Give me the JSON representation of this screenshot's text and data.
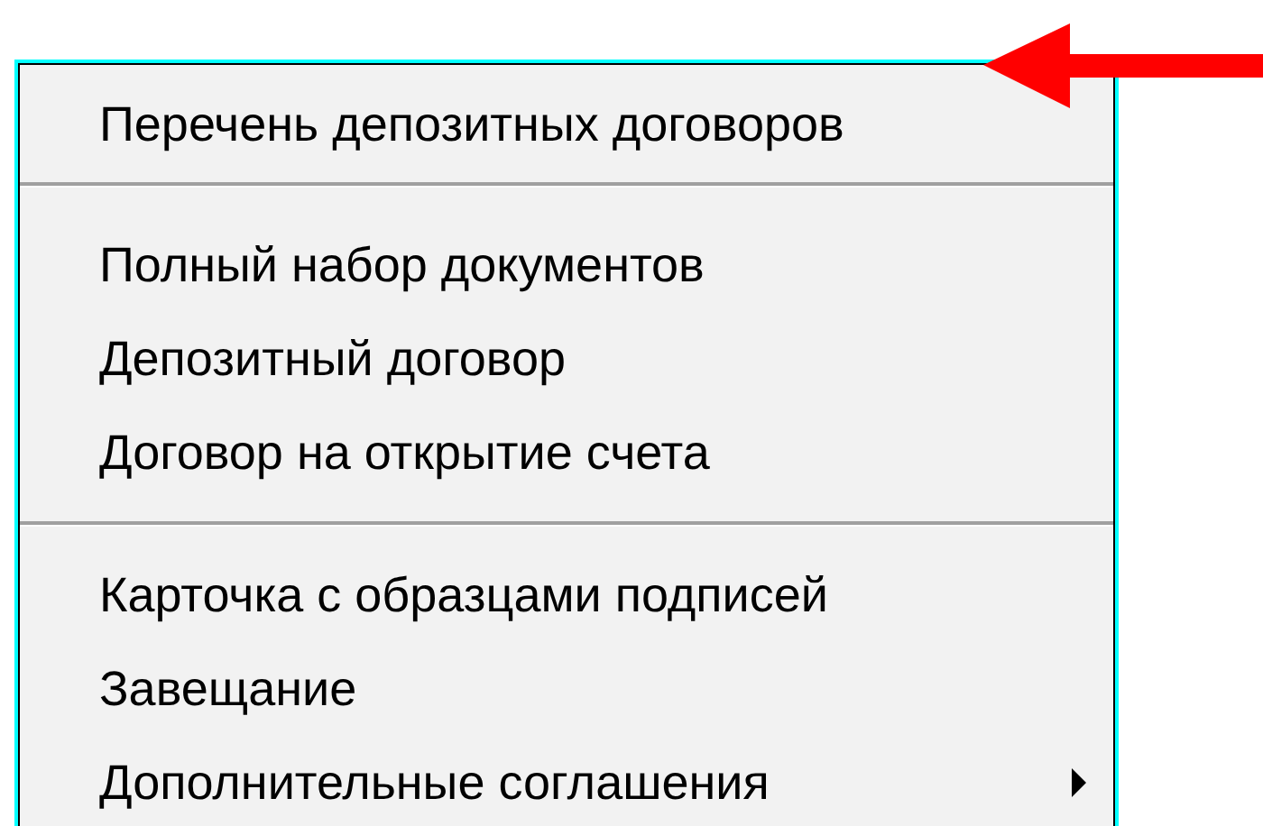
{
  "menu": {
    "items": [
      {
        "kind": "item",
        "label": "Перечень депозитных договоров",
        "has_submenu": false
      },
      {
        "kind": "separator"
      },
      {
        "kind": "item",
        "label": "Полный набор документов",
        "has_submenu": false
      },
      {
        "kind": "item",
        "label": "Депозитный договор",
        "has_submenu": false
      },
      {
        "kind": "item",
        "label": "Договор на открытие счета",
        "has_submenu": false
      },
      {
        "kind": "separator"
      },
      {
        "kind": "item",
        "label": "Карточка с образцами подписей",
        "has_submenu": false
      },
      {
        "kind": "item",
        "label": "Завещание",
        "has_submenu": false
      },
      {
        "kind": "item",
        "label": "Дополнительные соглашения",
        "has_submenu": true
      }
    ]
  }
}
